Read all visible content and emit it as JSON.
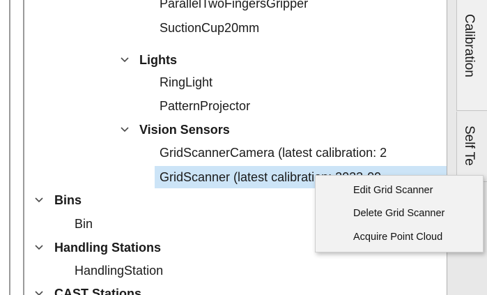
{
  "tree": {
    "items": [
      {
        "label": "ParallelTwoFingersGripper"
      },
      {
        "label": "SuctionCup20mm"
      },
      {
        "label": "Lights"
      },
      {
        "label": "RingLight"
      },
      {
        "label": "PatternProjector"
      },
      {
        "label": "Vision Sensors"
      },
      {
        "label": "GridScannerCamera (latest calibration: 2"
      },
      {
        "label": "GridScanner (latest calibration: 2023-09"
      },
      {
        "label": "Bins"
      },
      {
        "label": "Bin"
      },
      {
        "label": "Handling Stations"
      },
      {
        "label": "HandlingStation"
      },
      {
        "label": "CAST Stations"
      }
    ]
  },
  "tabs": {
    "calibration": "Calibration",
    "self_test": "Self Te"
  },
  "context_menu": {
    "items": [
      {
        "label": "Edit Grid Scanner"
      },
      {
        "label": "Delete Grid Scanner"
      },
      {
        "label": "Acquire Point Cloud"
      }
    ]
  },
  "colors": {
    "selection": "#cce4f7",
    "menu_background": "#f2f2f2",
    "tab_background": "#ececec"
  }
}
